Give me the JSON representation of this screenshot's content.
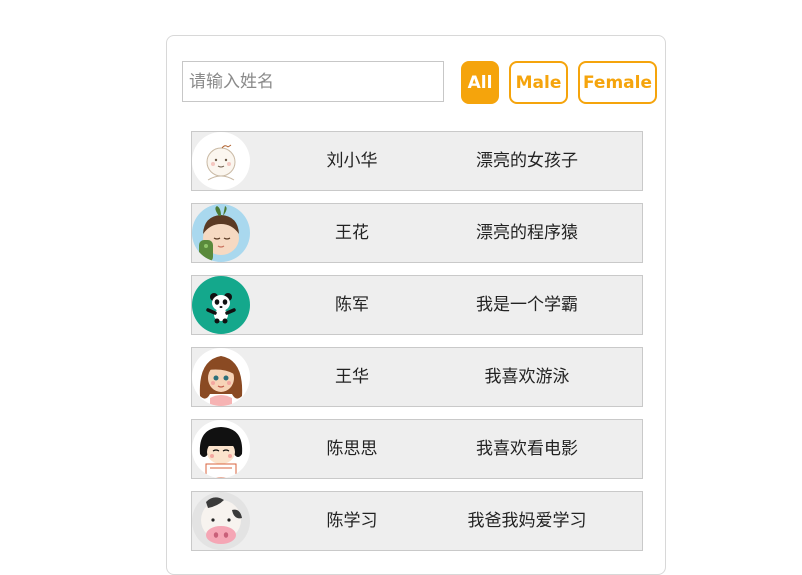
{
  "search": {
    "placeholder": "请输入姓名",
    "value": ""
  },
  "filters": [
    {
      "label": "All",
      "active": true
    },
    {
      "label": "Male",
      "active": false
    },
    {
      "label": "Female",
      "active": false
    }
  ],
  "users": [
    {
      "name": "刘小华",
      "desc": "漂亮的女孩子",
      "avatar_icon": "doodle-girl-icon"
    },
    {
      "name": "王花",
      "desc": "漂亮的程序猿",
      "avatar_icon": "girl-sprout-hair-icon"
    },
    {
      "name": "陈军",
      "desc": "我是一个学霸",
      "avatar_icon": "panda-icon"
    },
    {
      "name": "王华",
      "desc": "我喜欢游泳",
      "avatar_icon": "brown-hair-girl-icon"
    },
    {
      "name": "陈思思",
      "desc": "我喜欢看电影",
      "avatar_icon": "bob-hair-girl-icon"
    },
    {
      "name": "陈学习",
      "desc": "我爸我妈爱学习",
      "avatar_icon": "cow-icon"
    }
  ],
  "colors": {
    "accent": "#f5a40c",
    "row_bg": "#eeeeee",
    "panda_bg": "#14a88c"
  }
}
